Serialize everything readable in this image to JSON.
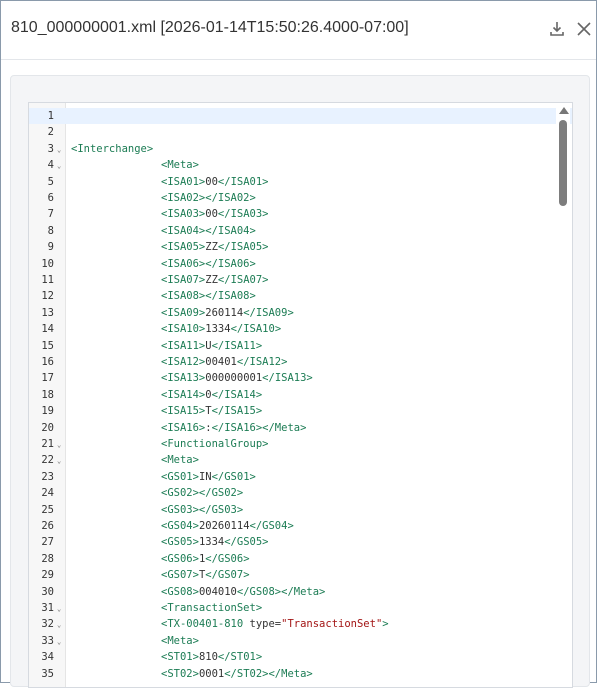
{
  "dialog": {
    "title": "810_000000001.xml [2026-01-14T15:50:26.4000-07:00]",
    "download_icon": "download-icon",
    "close_icon": "close-icon"
  },
  "editor": {
    "active_line": 1,
    "lines": [
      {
        "n": "1",
        "fold": false,
        "indent": 0,
        "segs": []
      },
      {
        "n": "2",
        "fold": false,
        "indent": 0,
        "segs": []
      },
      {
        "n": "3",
        "fold": true,
        "indent": 0,
        "segs": [
          {
            "k": "t",
            "s": "<Interchange>"
          }
        ]
      },
      {
        "n": "4",
        "fold": true,
        "indent": 1,
        "segs": [
          {
            "k": "t",
            "s": "<Meta>"
          }
        ]
      },
      {
        "n": "5",
        "fold": false,
        "indent": 1,
        "segs": [
          {
            "k": "t",
            "s": "<ISA01>"
          },
          {
            "k": "c",
            "s": "00"
          },
          {
            "k": "t",
            "s": "</ISA01>"
          }
        ]
      },
      {
        "n": "6",
        "fold": false,
        "indent": 1,
        "segs": [
          {
            "k": "t",
            "s": "<ISA02></ISA02>"
          }
        ]
      },
      {
        "n": "7",
        "fold": false,
        "indent": 1,
        "segs": [
          {
            "k": "t",
            "s": "<ISA03>"
          },
          {
            "k": "c",
            "s": "00"
          },
          {
            "k": "t",
            "s": "</ISA03>"
          }
        ]
      },
      {
        "n": "8",
        "fold": false,
        "indent": 1,
        "segs": [
          {
            "k": "t",
            "s": "<ISA04></ISA04>"
          }
        ]
      },
      {
        "n": "9",
        "fold": false,
        "indent": 1,
        "segs": [
          {
            "k": "t",
            "s": "<ISA05>"
          },
          {
            "k": "c",
            "s": "ZZ"
          },
          {
            "k": "t",
            "s": "</ISA05>"
          }
        ]
      },
      {
        "n": "10",
        "fold": false,
        "indent": 1,
        "segs": [
          {
            "k": "t",
            "s": "<ISA06></ISA06>"
          }
        ]
      },
      {
        "n": "11",
        "fold": false,
        "indent": 1,
        "segs": [
          {
            "k": "t",
            "s": "<ISA07>"
          },
          {
            "k": "c",
            "s": "ZZ"
          },
          {
            "k": "t",
            "s": "</ISA07>"
          }
        ]
      },
      {
        "n": "12",
        "fold": false,
        "indent": 1,
        "segs": [
          {
            "k": "t",
            "s": "<ISA08></ISA08>"
          }
        ]
      },
      {
        "n": "13",
        "fold": false,
        "indent": 1,
        "segs": [
          {
            "k": "t",
            "s": "<ISA09>"
          },
          {
            "k": "c",
            "s": "260114"
          },
          {
            "k": "t",
            "s": "</ISA09>"
          }
        ]
      },
      {
        "n": "14",
        "fold": false,
        "indent": 1,
        "segs": [
          {
            "k": "t",
            "s": "<ISA10>"
          },
          {
            "k": "c",
            "s": "1334"
          },
          {
            "k": "t",
            "s": "</ISA10>"
          }
        ]
      },
      {
        "n": "15",
        "fold": false,
        "indent": 1,
        "segs": [
          {
            "k": "t",
            "s": "<ISA11>"
          },
          {
            "k": "c",
            "s": "U"
          },
          {
            "k": "t",
            "s": "</ISA11>"
          }
        ]
      },
      {
        "n": "16",
        "fold": false,
        "indent": 1,
        "segs": [
          {
            "k": "t",
            "s": "<ISA12>"
          },
          {
            "k": "c",
            "s": "00401"
          },
          {
            "k": "t",
            "s": "</ISA12>"
          }
        ]
      },
      {
        "n": "17",
        "fold": false,
        "indent": 1,
        "segs": [
          {
            "k": "t",
            "s": "<ISA13>"
          },
          {
            "k": "c",
            "s": "000000001"
          },
          {
            "k": "t",
            "s": "</ISA13>"
          }
        ]
      },
      {
        "n": "18",
        "fold": false,
        "indent": 1,
        "segs": [
          {
            "k": "t",
            "s": "<ISA14>"
          },
          {
            "k": "c",
            "s": "0"
          },
          {
            "k": "t",
            "s": "</ISA14>"
          }
        ]
      },
      {
        "n": "19",
        "fold": false,
        "indent": 1,
        "segs": [
          {
            "k": "t",
            "s": "<ISA15>"
          },
          {
            "k": "c",
            "s": "T"
          },
          {
            "k": "t",
            "s": "</ISA15>"
          }
        ]
      },
      {
        "n": "20",
        "fold": false,
        "indent": 1,
        "segs": [
          {
            "k": "t",
            "s": "<ISA16>"
          },
          {
            "k": "c",
            "s": ":"
          },
          {
            "k": "t",
            "s": "</ISA16></Meta>"
          }
        ]
      },
      {
        "n": "21",
        "fold": true,
        "indent": 1,
        "segs": [
          {
            "k": "t",
            "s": "<FunctionalGroup>"
          }
        ]
      },
      {
        "n": "22",
        "fold": true,
        "indent": 1,
        "segs": [
          {
            "k": "t",
            "s": "<Meta>"
          }
        ]
      },
      {
        "n": "23",
        "fold": false,
        "indent": 1,
        "segs": [
          {
            "k": "t",
            "s": "<GS01>"
          },
          {
            "k": "c",
            "s": "IN"
          },
          {
            "k": "t",
            "s": "</GS01>"
          }
        ]
      },
      {
        "n": "24",
        "fold": false,
        "indent": 1,
        "segs": [
          {
            "k": "t",
            "s": "<GS02></GS02>"
          }
        ]
      },
      {
        "n": "25",
        "fold": false,
        "indent": 1,
        "segs": [
          {
            "k": "t",
            "s": "<GS03></GS03>"
          }
        ]
      },
      {
        "n": "26",
        "fold": false,
        "indent": 1,
        "segs": [
          {
            "k": "t",
            "s": "<GS04>"
          },
          {
            "k": "c",
            "s": "20260114"
          },
          {
            "k": "t",
            "s": "</GS04>"
          }
        ]
      },
      {
        "n": "27",
        "fold": false,
        "indent": 1,
        "segs": [
          {
            "k": "t",
            "s": "<GS05>"
          },
          {
            "k": "c",
            "s": "1334"
          },
          {
            "k": "t",
            "s": "</GS05>"
          }
        ]
      },
      {
        "n": "28",
        "fold": false,
        "indent": 1,
        "segs": [
          {
            "k": "t",
            "s": "<GS06>"
          },
          {
            "k": "c",
            "s": "1"
          },
          {
            "k": "t",
            "s": "</GS06>"
          }
        ]
      },
      {
        "n": "29",
        "fold": false,
        "indent": 1,
        "segs": [
          {
            "k": "t",
            "s": "<GS07>"
          },
          {
            "k": "c",
            "s": "T"
          },
          {
            "k": "t",
            "s": "</GS07>"
          }
        ]
      },
      {
        "n": "30",
        "fold": false,
        "indent": 1,
        "segs": [
          {
            "k": "t",
            "s": "<GS08>"
          },
          {
            "k": "c",
            "s": "004010"
          },
          {
            "k": "t",
            "s": "</GS08></Meta>"
          }
        ]
      },
      {
        "n": "31",
        "fold": true,
        "indent": 1,
        "segs": [
          {
            "k": "t",
            "s": "<TransactionSet>"
          }
        ]
      },
      {
        "n": "32",
        "fold": true,
        "indent": 1,
        "segs": [
          {
            "k": "t",
            "s": "<TX-00401-810 "
          },
          {
            "k": "a",
            "s": "type="
          },
          {
            "k": "v",
            "s": "\"TransactionSet\""
          },
          {
            "k": "t",
            "s": ">"
          }
        ]
      },
      {
        "n": "33",
        "fold": true,
        "indent": 1,
        "segs": [
          {
            "k": "t",
            "s": "<Meta>"
          }
        ]
      },
      {
        "n": "34",
        "fold": false,
        "indent": 1,
        "segs": [
          {
            "k": "t",
            "s": "<ST01>"
          },
          {
            "k": "c",
            "s": "810"
          },
          {
            "k": "t",
            "s": "</ST01>"
          }
        ]
      },
      {
        "n": "35",
        "fold": false,
        "indent": 1,
        "segs": [
          {
            "k": "t",
            "s": "<ST02>"
          },
          {
            "k": "c",
            "s": "0001"
          },
          {
            "k": "t",
            "s": "</ST02></Meta>"
          }
        ]
      }
    ]
  },
  "scrollbar": {
    "position": 0.0
  }
}
